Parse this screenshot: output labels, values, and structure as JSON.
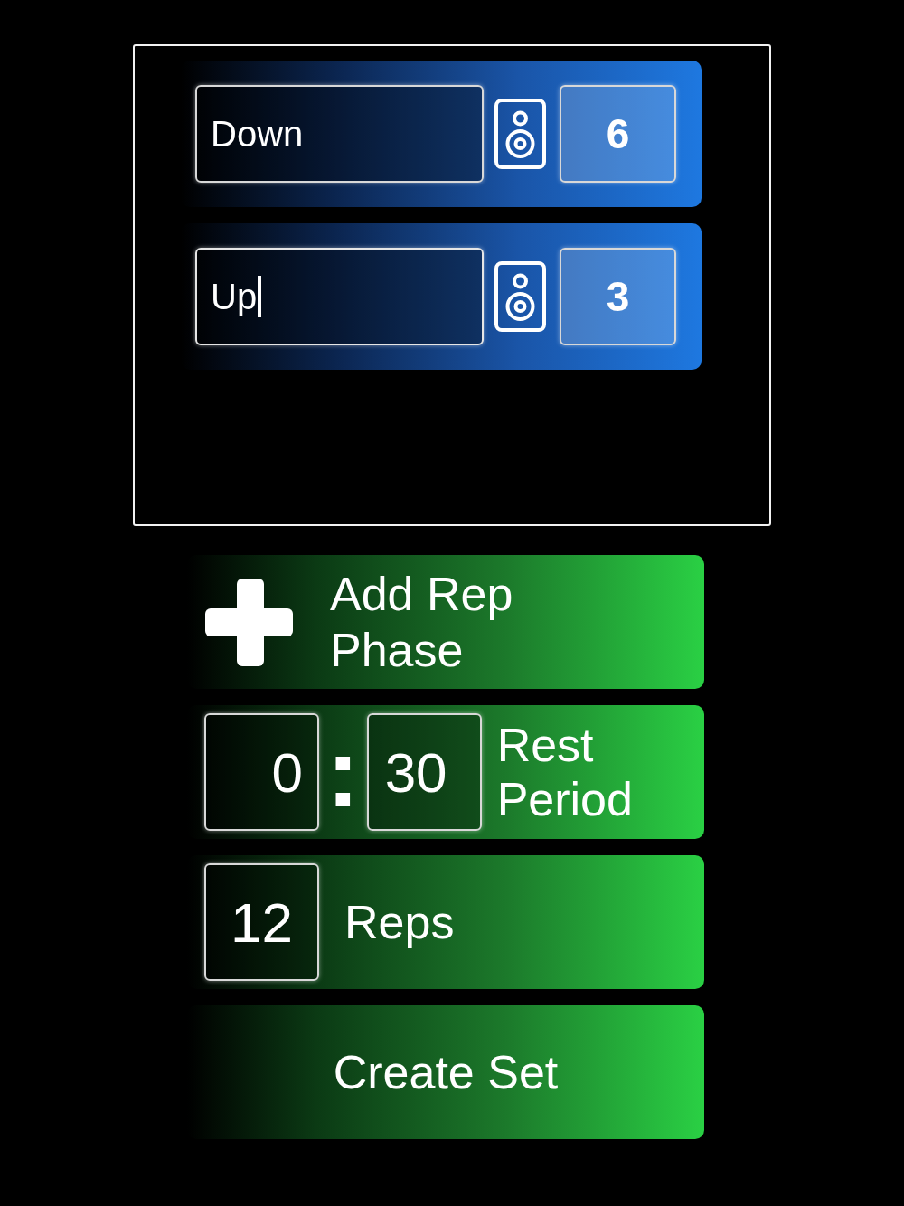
{
  "phases": [
    {
      "name": "Down",
      "count": "6",
      "focused": false
    },
    {
      "name": "Up",
      "count": "3",
      "focused": true
    }
  ],
  "add_phase_button": {
    "label": "Add Rep Phase"
  },
  "rest_period": {
    "minutes": "0",
    "separator": ":",
    "seconds": "30",
    "label": "Rest Period"
  },
  "reps": {
    "value": "12",
    "label": "Reps"
  },
  "create_button": {
    "label": "Create Set"
  }
}
